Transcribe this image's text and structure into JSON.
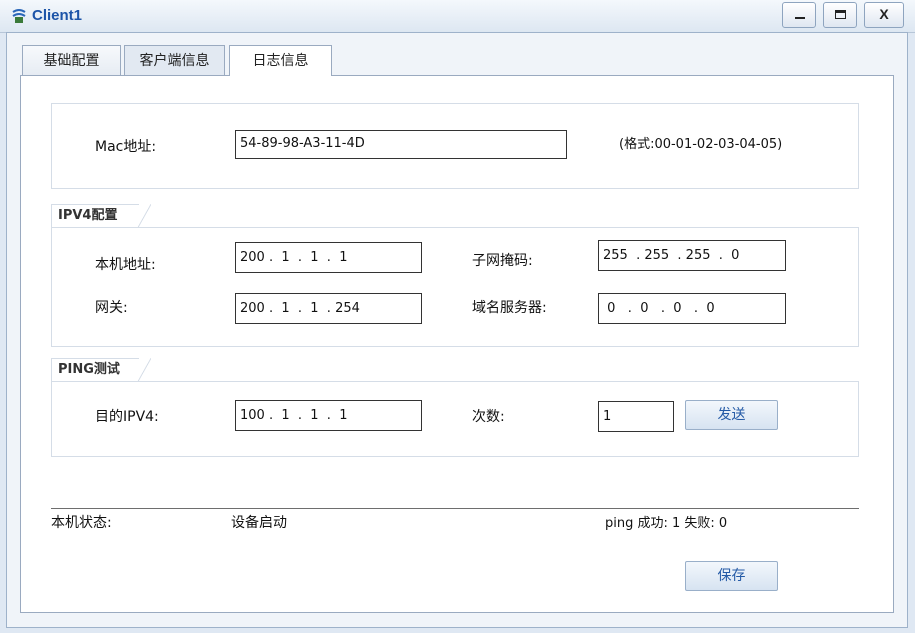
{
  "window": {
    "title": "Client1",
    "controls": {
      "minimize": "_",
      "maximize": "□",
      "close": "X"
    }
  },
  "tabs": [
    {
      "label": "基础配置"
    },
    {
      "label": "客户端信息"
    },
    {
      "label": "日志信息"
    }
  ],
  "mac": {
    "label": "Mac地址:",
    "value": "54-89-98-A3-11-4D",
    "format_hint": "(格式:00-01-02-03-04-05)"
  },
  "ipv4": {
    "section_title": "IPV4配置",
    "host_label": "本机地址:",
    "host_value": "200 .  1  .  1  .  1",
    "mask_label": "子网掩码:",
    "mask_value": "255  . 255  . 255  .  0",
    "gateway_label": "网关:",
    "gateway_value": "200 .  1  .  1  . 254",
    "dns_label": "域名服务器:",
    "dns_value": " 0   .  0   .  0   .  0"
  },
  "ping": {
    "section_title": "PING测试",
    "target_label": "目的IPV4:",
    "target_value": "100 .  1  .  1  .  1",
    "count_label": "次数:",
    "count_value": "1",
    "send_label": "发送"
  },
  "status": {
    "label": "本机状态:",
    "value": "设备启动",
    "ping_result": "ping 成功: 1   失败: 0"
  },
  "save_label": "保存",
  "colors": {
    "accent": "#245aa6",
    "title": "#1c54a8",
    "background": "#dfe8f3"
  }
}
